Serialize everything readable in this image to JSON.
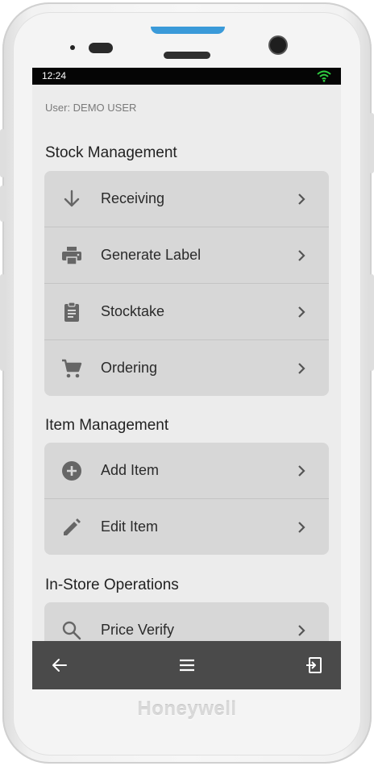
{
  "device": {
    "brand": "Honeywell"
  },
  "status_bar": {
    "time": "12:24",
    "wifi_color": "#2ecc40"
  },
  "header": {
    "user_text": "User: DEMO USER"
  },
  "sections": [
    {
      "title": "Stock Management",
      "items": [
        {
          "label": "Receiving",
          "icon": "arrow-down-icon"
        },
        {
          "label": "Generate Label",
          "icon": "printer-icon"
        },
        {
          "label": "Stocktake",
          "icon": "clipboard-icon"
        },
        {
          "label": "Ordering",
          "icon": "cart-icon"
        }
      ]
    },
    {
      "title": "Item Management",
      "items": [
        {
          "label": "Add Item",
          "icon": "add-circle-icon"
        },
        {
          "label": "Edit Item",
          "icon": "pencil-icon"
        }
      ]
    },
    {
      "title": "In-Store Operations",
      "items": [
        {
          "label": "Price Verify",
          "icon": "search-icon"
        }
      ]
    }
  ],
  "nav": {
    "back_icon": "back-arrow-icon",
    "menu_icon": "menu-icon",
    "exit_icon": "exit-icon"
  },
  "colors": {
    "accent_scan": "#3a9ad9",
    "card_bg": "#d7d7d7",
    "screen_bg": "#ececec",
    "nav_bg": "#4a4a4a"
  }
}
